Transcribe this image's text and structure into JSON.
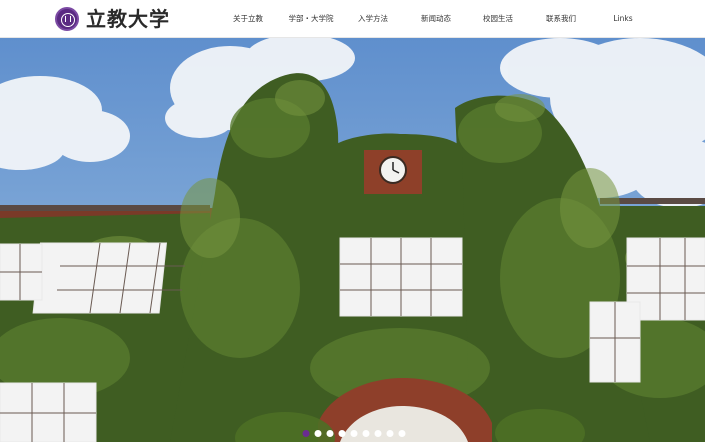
{
  "header": {
    "logo_text": "立教大学"
  },
  "nav": {
    "items": [
      {
        "label": "关于立教"
      },
      {
        "label": "学部・大学院"
      },
      {
        "label": "入学方法"
      },
      {
        "label": "新闻动态"
      },
      {
        "label": "校园生活"
      },
      {
        "label": "联系我们"
      },
      {
        "label": "Links"
      }
    ]
  },
  "carousel": {
    "slide_count": 9,
    "active_index": 0
  },
  "colors": {
    "brand_purple": "#5a2a82",
    "active_dot": "#6a2c91"
  },
  "icons": {
    "logo": "university-seal-icon"
  }
}
